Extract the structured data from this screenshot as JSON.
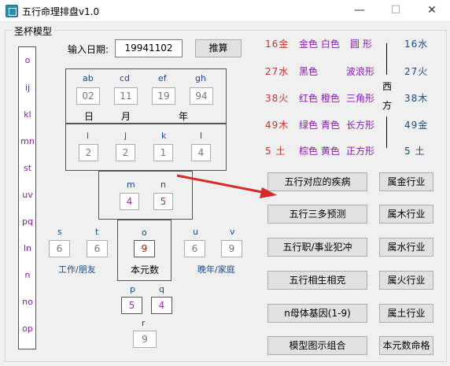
{
  "window": {
    "title": "五行命理排盘v1.0",
    "minimize_glyph": "—",
    "maximize_glyph": "☐",
    "close_glyph": "✕"
  },
  "group_label": "圣杯模型",
  "vertical_list": [
    "o",
    "ij",
    "kl",
    "mn",
    "st",
    "uv",
    "pq",
    "ln",
    "n",
    "no",
    "op"
  ],
  "date": {
    "label": "输入日期:",
    "value": "19941102",
    "button": "推算"
  },
  "top_grid": {
    "headers": [
      "ab",
      "cd",
      "ef",
      "gh"
    ],
    "values": [
      "02",
      "11",
      "19",
      "94"
    ],
    "units": [
      "日",
      "月",
      "年"
    ]
  },
  "mid_grid": {
    "headers": [
      "i",
      "j",
      "k",
      "l"
    ],
    "values": [
      "2",
      "2",
      "1",
      "4"
    ]
  },
  "mn": {
    "headers": [
      "m",
      "n"
    ],
    "values": [
      "4",
      "5"
    ]
  },
  "st": {
    "headers": [
      "s",
      "t"
    ],
    "values": [
      "6",
      "6"
    ],
    "caption": "工作/朋友"
  },
  "o": {
    "header": "o",
    "value": "9",
    "caption": "本元数"
  },
  "uv": {
    "headers": [
      "u",
      "v"
    ],
    "values": [
      "6",
      "9"
    ],
    "caption": "晚年/家庭"
  },
  "pq": {
    "headers": [
      "p",
      "q"
    ],
    "values": [
      "5",
      "4"
    ]
  },
  "r": {
    "header": "r",
    "value": "9"
  },
  "legend": {
    "rows": [
      {
        "left": "16金",
        "colors": "金色 白色",
        "shape": "圆 形",
        "right": "16水",
        "style": "red"
      },
      {
        "left": "27水",
        "colors": "黑色",
        "shape": "波浪形",
        "right": "27火",
        "style": "red"
      },
      {
        "left": "38火",
        "colors": "红色 橙色",
        "shape": "三角形",
        "right": "38木",
        "style": "red"
      },
      {
        "left": "49木",
        "colors": "绿色 青色",
        "shape": "长方形",
        "right": "49金",
        "style": "red"
      },
      {
        "left": "5 土",
        "colors": "棕色 黄色",
        "shape": "正方形",
        "right": "5 土",
        "style": "red"
      }
    ],
    "direction": [
      "西",
      "方"
    ]
  },
  "action_buttons": [
    "五行对应的疾病",
    "五行三多预测",
    "五行职/事业犯冲",
    "五行相生相克",
    "n母体基因(1-9)",
    "模型图示组合"
  ],
  "industry_buttons": [
    "属金行业",
    "属木行业",
    "属水行业",
    "属火行业",
    "属土行业",
    "本元数命格"
  ],
  "colors": {
    "red": "#c0322b",
    "blue": "#1a4a8c",
    "purple": "#8a19b5",
    "arrow": "#d62b2b"
  }
}
